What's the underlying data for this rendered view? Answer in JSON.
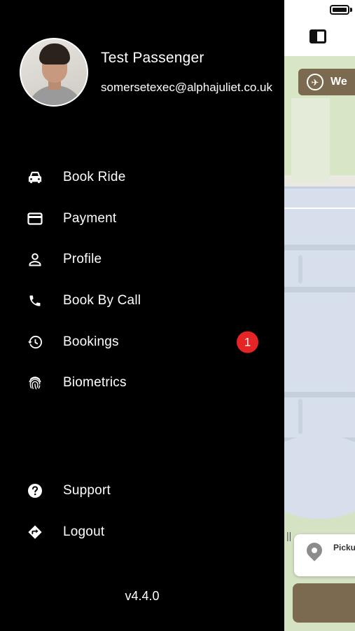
{
  "user": {
    "name": "Test Passenger",
    "email": "somersetexec@alphajuliet.co.uk"
  },
  "menu": [
    {
      "label": "Book Ride",
      "icon": "car-icon"
    },
    {
      "label": "Payment",
      "icon": "credit-card-icon"
    },
    {
      "label": "Profile",
      "icon": "person-icon"
    },
    {
      "label": "Book By Call",
      "icon": "phone-icon"
    },
    {
      "label": "Bookings",
      "icon": "history-icon",
      "badge": "1"
    },
    {
      "label": "Biometrics",
      "icon": "fingerprint-icon"
    }
  ],
  "footer_menu": [
    {
      "label": "Support",
      "icon": "help-circle-icon"
    },
    {
      "label": "Logout",
      "icon": "directions-diamond-icon"
    }
  ],
  "version": "v4.4.0",
  "map": {
    "welcome_pill_text": "We",
    "pickup_label": "Pickup"
  },
  "colors": {
    "drawer_bg": "#000000",
    "accent_brown": "#7b6a4f",
    "badge_red": "#e52525"
  }
}
